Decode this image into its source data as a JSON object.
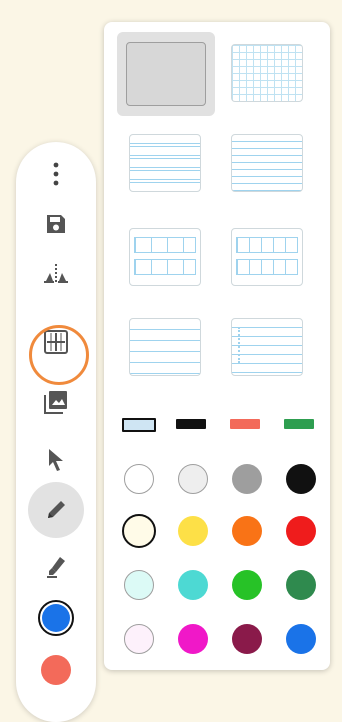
{
  "toolbar": {
    "tools": [
      {
        "name": "more-options-icon"
      },
      {
        "name": "save-icon"
      },
      {
        "name": "mirror-icon"
      },
      {
        "name": "page-templates-icon",
        "state": "selected-highlighted"
      },
      {
        "name": "insert-image-icon"
      },
      {
        "name": "pointer-icon"
      },
      {
        "name": "pen-icon",
        "state": "active"
      },
      {
        "name": "highlighter-icon"
      },
      {
        "name": "current-color-indicator",
        "color": "#1a73e8"
      },
      {
        "name": "secondary-color-indicator",
        "color": "#f36a5a"
      }
    ]
  },
  "panel": {
    "templates": [
      {
        "name": "blank",
        "selected": true
      },
      {
        "name": "grid"
      },
      {
        "name": "handwriting-lines"
      },
      {
        "name": "ruled-lines"
      },
      {
        "name": "boxes-grid"
      },
      {
        "name": "boxes-grid-alt"
      },
      {
        "name": "lined"
      },
      {
        "name": "music-staff"
      }
    ],
    "pen_sizes": [
      {
        "color": "#cfe5f3",
        "selected": true
      },
      {
        "color": "#111111"
      },
      {
        "color": "#f36a5a"
      },
      {
        "color": "#2e9e50"
      }
    ],
    "colors": [
      [
        "#ffffff",
        "#eeeeee",
        "#9e9e9e",
        "#111111"
      ],
      [
        "#fffbe8",
        "#fde047",
        "#f97316",
        "#ef1c1c"
      ],
      [
        "#dcfaf6",
        "#4dd9d3",
        "#27c227",
        "#2f8a4e"
      ],
      [
        "#fdf1fb",
        "#f018c8",
        "#8a1a4a",
        "#1a73e8"
      ]
    ],
    "selected_color": "#fffbe8"
  }
}
